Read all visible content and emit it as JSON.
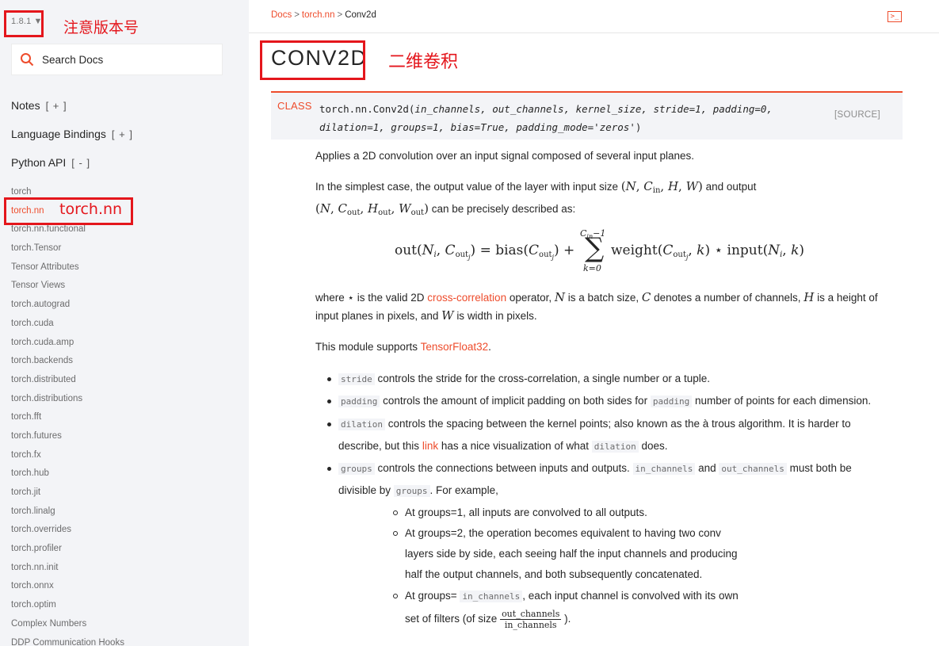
{
  "sidebar": {
    "version": "1.8.1",
    "version_arrow": "▼",
    "annotation_version": "注意版本号",
    "annotation_torchnn": "torch.nn",
    "search_placeholder": "Search Docs",
    "sections": [
      {
        "label": "Notes",
        "toggle": "[ + ]"
      },
      {
        "label": "Language Bindings",
        "toggle": "[ + ]"
      },
      {
        "label": "Python API",
        "toggle": "[ - ]"
      }
    ],
    "items": [
      "torch",
      "torch.nn",
      "torch.nn.functional",
      "torch.Tensor",
      "Tensor Attributes",
      "Tensor Views",
      "torch.autograd",
      "torch.cuda",
      "torch.cuda.amp",
      "torch.backends",
      "torch.distributed",
      "torch.distributions",
      "torch.fft",
      "torch.futures",
      "torch.fx",
      "torch.hub",
      "torch.jit",
      "torch.linalg",
      "torch.overrides",
      "torch.profiler",
      "torch.nn.init",
      "torch.onnx",
      "torch.optim",
      "Complex Numbers",
      "DDP Communication Hooks"
    ],
    "active_item": "torch.nn"
  },
  "breadcrumb": {
    "docs": "Docs",
    "sep": ">",
    "nn": "torch.nn",
    "current": "Conv2d"
  },
  "console_icon": "terminal-icon",
  "title": "CONV2D",
  "title_annotation": "二维卷积",
  "signature": {
    "class_label": "CLASS",
    "name": "torch.nn.Conv2d(",
    "params_line1": "in_channels, out_channels, kernel_size, stride=1, padding=0,",
    "params_line2": "dilation=1, groups=1, bias=True, padding_mode='zeros'",
    "close": ")",
    "source": "[SOURCE]"
  },
  "body": {
    "intro": "Applies a 2D convolution over an input signal composed of several input planes.",
    "simplest_1": "In the simplest case, the output value of the layer with input size",
    "simplest_2": "and output",
    "simplest_3": "can be precisely described as:",
    "where_1": "where",
    "where_2": "is the valid 2D",
    "where_link": "cross-correlation",
    "where_3": "operator,",
    "where_4": "is a batch size,",
    "where_5": "denotes a number of channels,",
    "where_6": "is a height of",
    "where_7": "input planes in pixels, and",
    "where_8": "is width in pixels.",
    "supports": "This module supports",
    "supports_link": "TensorFloat32",
    "period": "."
  },
  "bullets": {
    "stride_code": "stride",
    "stride_text": "controls the stride for the cross-correlation, a single number or a tuple.",
    "padding_code": "padding",
    "padding_text1": "controls the amount of implicit padding on both sides for",
    "padding_code2": "padding",
    "padding_text2": "number of points for each dimension.",
    "dilation_code": "dilation",
    "dilation_text1": "controls the spacing between the kernel points; also known as the à trous algorithm. It is harder to",
    "dilation_text2": "describe, but this",
    "dilation_link": "link",
    "dilation_text3": "has a nice visualization of what",
    "dilation_code2": "dilation",
    "dilation_text4": "does.",
    "groups_code": "groups",
    "groups_text1": "controls the connections between inputs and outputs.",
    "groups_code_in": "in_channels",
    "groups_and": "and",
    "groups_code_out": "out_channels",
    "groups_text2": "must both be",
    "groups_text3": "divisible by",
    "groups_code2": "groups",
    "groups_text4": ". For example,",
    "sub1": "At groups=1, all inputs are convolved to all outputs.",
    "sub2_l1": "At groups=2, the operation becomes equivalent to having two conv",
    "sub2_l2": "layers side by side, each seeing half the input channels and producing",
    "sub2_l3": "half the output channels, and both subsequently concatenated.",
    "sub3_a": "At groups=",
    "sub3_code": "in_channels",
    "sub3_b": ", each input channel is convolved with its own",
    "sub3_c": "set of filters (of size",
    "sub3_frac_num": "out_channels",
    "sub3_frac_den": "in_channels",
    "sub3_d": ")."
  }
}
